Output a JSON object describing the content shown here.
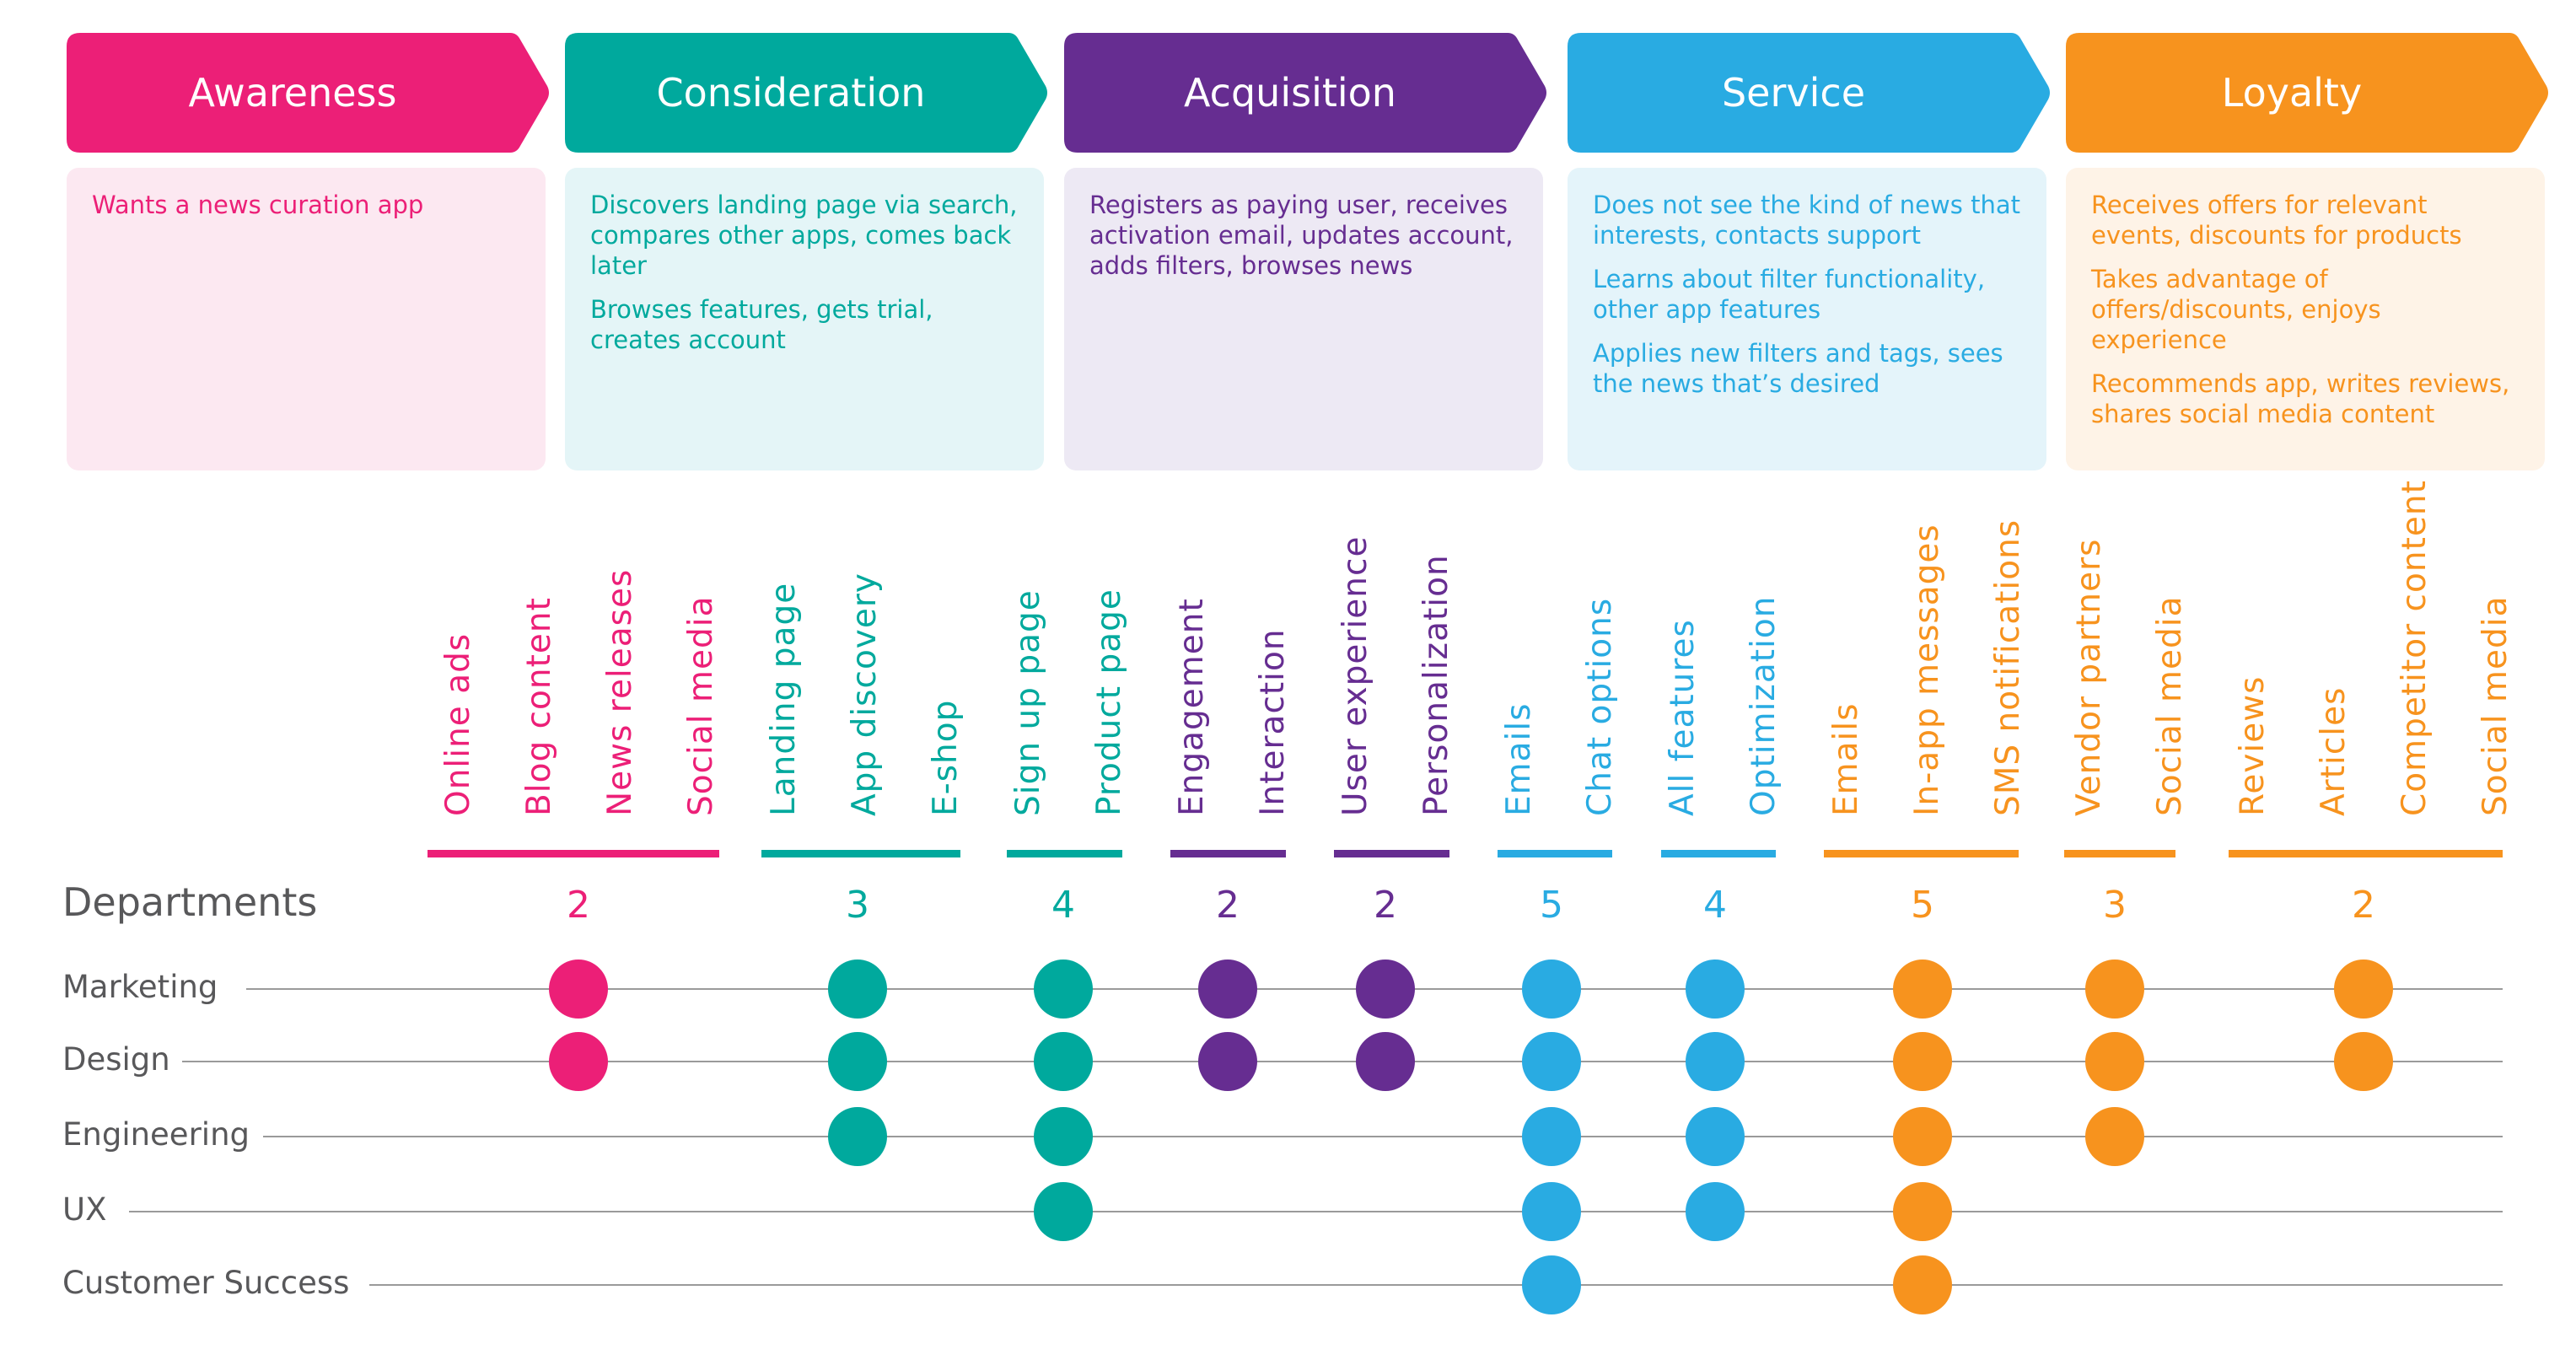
{
  "colors": {
    "awareness": "#ec1f77",
    "consideration": "#00a99d",
    "acquisition": "#662d91",
    "service": "#29abe2",
    "loyalty": "#f7931e",
    "text_gray": "#58585a"
  },
  "stages": [
    {
      "key": "awareness",
      "title": "Awareness",
      "card_bg": "#fce8f1",
      "items": [
        "Wants a news curation app"
      ]
    },
    {
      "key": "consideration",
      "title": "Consideration",
      "card_bg": "#e4f5f7",
      "items": [
        "Discovers landing page via search, compares other apps, comes back later",
        "Browses features, gets trial, creates account"
      ]
    },
    {
      "key": "acquisition",
      "title": "Acquisition",
      "card_bg": "#ede9f4",
      "items": [
        "Registers as paying user, receives activation email, updates account, adds filters, browses news"
      ]
    },
    {
      "key": "service",
      "title": "Service",
      "card_bg": "#e4f4fa",
      "items": [
        "Does not see the kind of news that interests, contacts support",
        "Learns about filter functionality, other app features",
        "Applies new filters and tags, sees the news that’s desired"
      ]
    },
    {
      "key": "loyalty",
      "title": "Loyalty",
      "card_bg": "#fef3e7",
      "items": [
        "Receives offers for relevant events, discounts for products",
        "Takes advantage of offers/discounts, enjoys experience",
        "Recommends app, writes reviews, shares social media content"
      ]
    }
  ],
  "touchpoints": [
    {
      "label": "Online ads",
      "stage": "awareness"
    },
    {
      "label": "Blog content",
      "stage": "awareness"
    },
    {
      "label": "News releases",
      "stage": "awareness"
    },
    {
      "label": "Social media",
      "stage": "awareness"
    },
    {
      "label": "Landing page",
      "stage": "consideration"
    },
    {
      "label": "App discovery",
      "stage": "consideration"
    },
    {
      "label": "E-shop",
      "stage": "consideration"
    },
    {
      "label": "Sign up page",
      "stage": "consideration"
    },
    {
      "label": "Product page",
      "stage": "consideration"
    },
    {
      "label": "Engagement",
      "stage": "acquisition"
    },
    {
      "label": "Interaction",
      "stage": "acquisition"
    },
    {
      "label": "User experience",
      "stage": "acquisition"
    },
    {
      "label": "Personalization",
      "stage": "acquisition"
    },
    {
      "label": "Emails",
      "stage": "service"
    },
    {
      "label": "Chat options",
      "stage": "service"
    },
    {
      "label": "All features",
      "stage": "service"
    },
    {
      "label": "Optimization",
      "stage": "service"
    },
    {
      "label": "Emails",
      "stage": "loyalty"
    },
    {
      "label": "In-app messages",
      "stage": "loyalty"
    },
    {
      "label": "SMS notifications",
      "stage": "loyalty"
    },
    {
      "label": "Vendor partners",
      "stage": "loyalty"
    },
    {
      "label": "Social media",
      "stage": "loyalty"
    },
    {
      "label": "Reviews",
      "stage": "loyalty"
    },
    {
      "label": "Articles",
      "stage": "loyalty"
    },
    {
      "label": "Competitor content",
      "stage": "loyalty"
    },
    {
      "label": "Social media",
      "stage": "loyalty"
    }
  ],
  "groups": [
    {
      "stage": "awareness",
      "touchpoints": [
        0,
        1,
        2,
        3
      ],
      "count": "2",
      "departments": [
        "Marketing",
        "Design"
      ]
    },
    {
      "stage": "consideration",
      "touchpoints": [
        4,
        5,
        6
      ],
      "count": "3",
      "departments": [
        "Marketing",
        "Design",
        "Engineering"
      ]
    },
    {
      "stage": "consideration",
      "touchpoints": [
        7,
        8
      ],
      "count": "4",
      "departments": [
        "Marketing",
        "Design",
        "Engineering",
        "UX"
      ]
    },
    {
      "stage": "acquisition",
      "touchpoints": [
        9,
        10
      ],
      "count": "2",
      "departments": [
        "Marketing",
        "Design"
      ]
    },
    {
      "stage": "acquisition",
      "touchpoints": [
        11,
        12
      ],
      "count": "2",
      "departments": [
        "Marketing",
        "Design"
      ]
    },
    {
      "stage": "service",
      "touchpoints": [
        13,
        14
      ],
      "count": "5",
      "departments": [
        "Marketing",
        "Design",
        "Engineering",
        "UX",
        "Customer Success"
      ]
    },
    {
      "stage": "service",
      "touchpoints": [
        15,
        16
      ],
      "count": "4",
      "departments": [
        "Marketing",
        "Design",
        "Engineering",
        "UX"
      ]
    },
    {
      "stage": "loyalty",
      "touchpoints": [
        17,
        18,
        19
      ],
      "count": "5",
      "departments": [
        "Marketing",
        "Design",
        "Engineering",
        "UX",
        "Customer Success"
      ]
    },
    {
      "stage": "loyalty",
      "touchpoints": [
        20,
        21
      ],
      "count": "3",
      "departments": [
        "Marketing",
        "Design",
        "Engineering"
      ]
    },
    {
      "stage": "loyalty",
      "touchpoints": [
        22,
        23,
        24,
        25
      ],
      "count": "2",
      "departments": [
        "Marketing",
        "Design"
      ]
    }
  ],
  "departments_heading": "Departments",
  "departments": [
    "Marketing",
    "Design",
    "Engineering",
    "UX",
    "Customer Success"
  ]
}
